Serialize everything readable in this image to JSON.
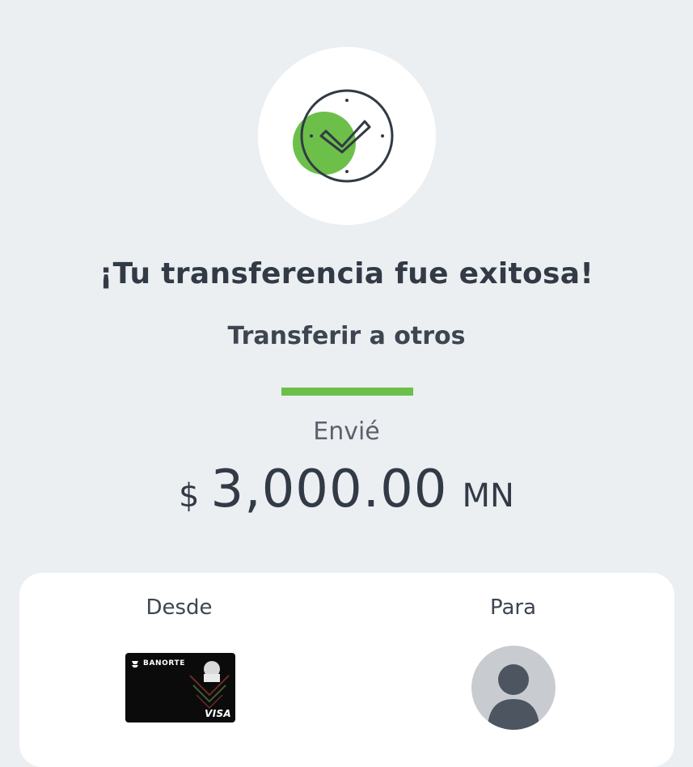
{
  "success": {
    "title": "¡Tu transferencia fue exitosa!",
    "subtitle": "Transferir a otros",
    "icon": "success-clock-check-icon"
  },
  "accent_color": "#6cc04a",
  "amount": {
    "label": "Envié",
    "currency_sign": "$",
    "value": "3,000.00",
    "currency_code": "MN"
  },
  "details": {
    "from_label": "Desde",
    "to_label": "Para",
    "from_card": {
      "bank_name": "BANORTE",
      "network": "VISA",
      "icon": "bank-card-image"
    },
    "to_avatar": {
      "icon": "user-avatar-icon"
    }
  }
}
